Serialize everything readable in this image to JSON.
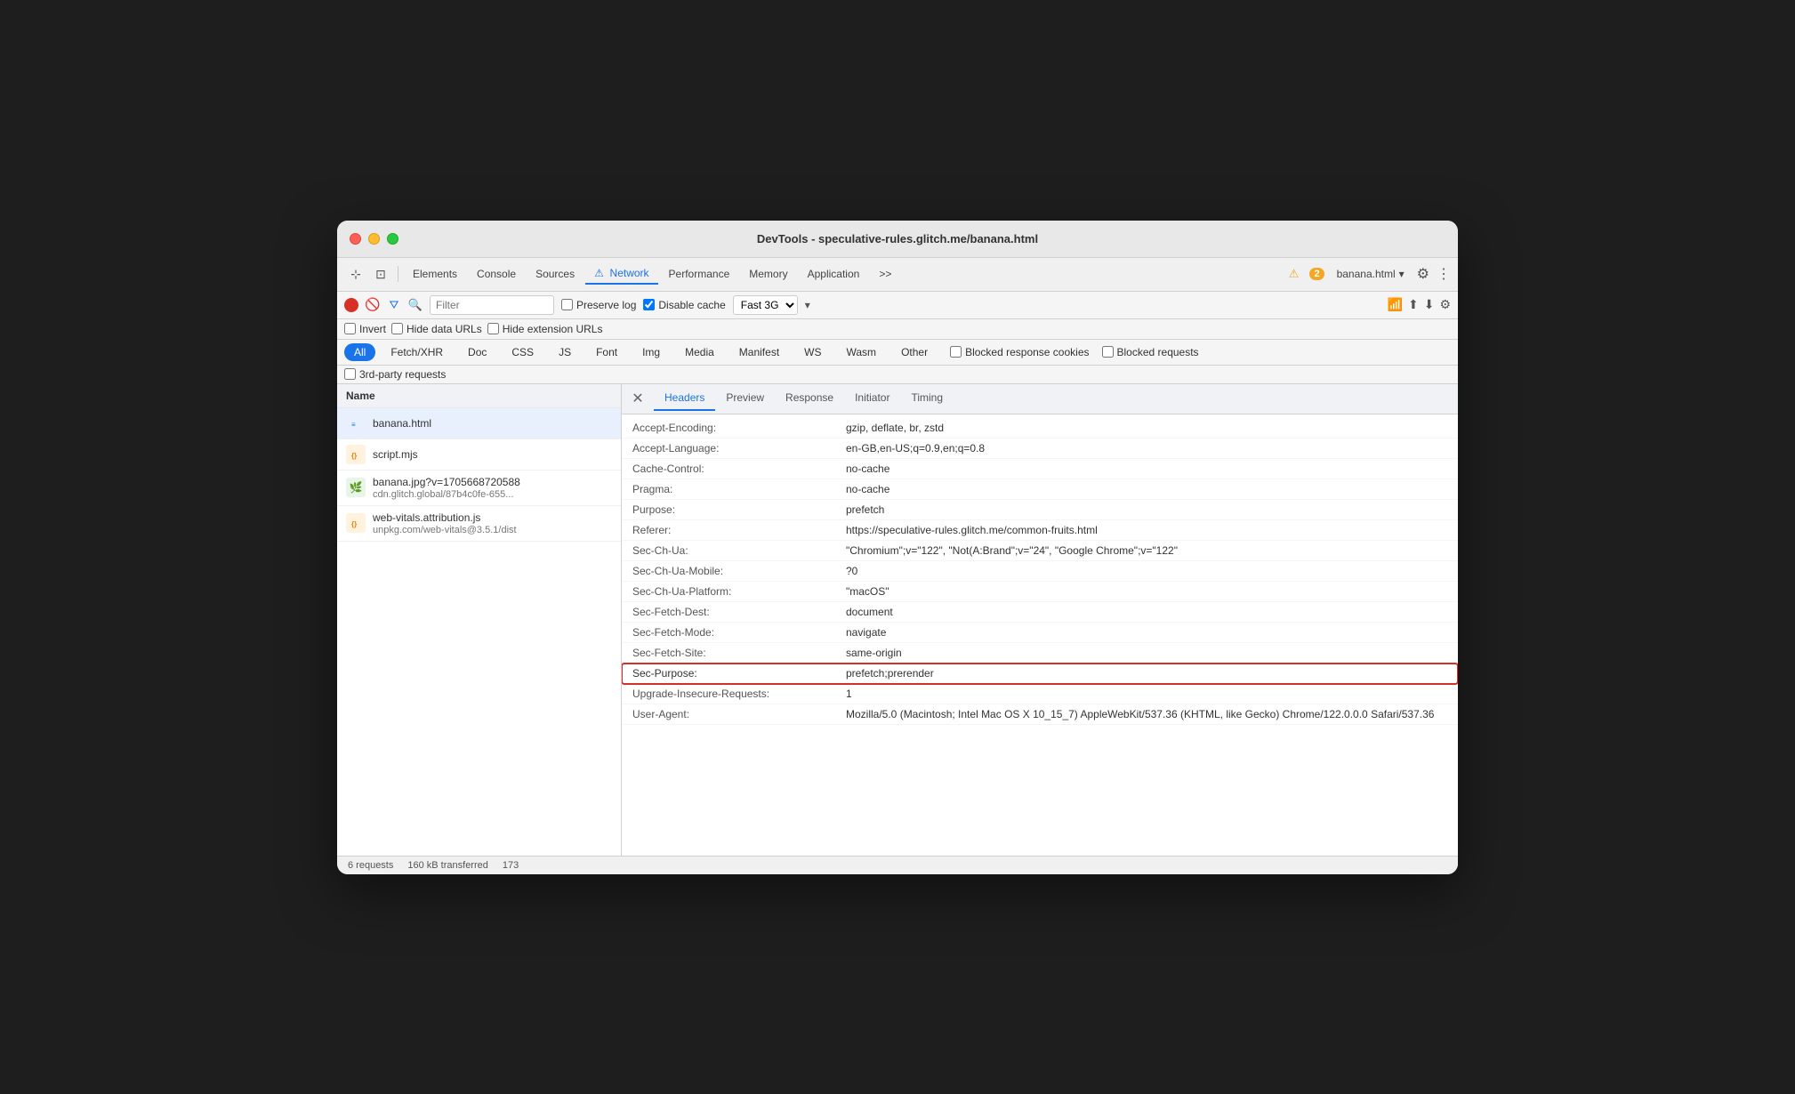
{
  "window": {
    "title": "DevTools - speculative-rules.glitch.me/banana.html"
  },
  "toolbar": {
    "tabs": [
      {
        "id": "elements",
        "label": "Elements",
        "active": false
      },
      {
        "id": "console",
        "label": "Console",
        "active": false
      },
      {
        "id": "sources",
        "label": "Sources",
        "active": false
      },
      {
        "id": "network",
        "label": "⚠ Network",
        "active": true
      },
      {
        "id": "performance",
        "label": "Performance",
        "active": false
      },
      {
        "id": "memory",
        "label": "Memory",
        "active": false
      },
      {
        "id": "application",
        "label": "Application",
        "active": false
      },
      {
        "id": "more",
        "label": ">>",
        "active": false
      }
    ],
    "warning_count": "2",
    "filename": "banana.html"
  },
  "controls": {
    "preserve_log": "Preserve log",
    "disable_cache": "Disable cache",
    "throttle": "Fast 3G",
    "filter_placeholder": "Filter",
    "invert": "Invert",
    "hide_data_urls": "Hide data URLs",
    "hide_extension_urls": "Hide extension URLs"
  },
  "filter_chips": [
    {
      "id": "all",
      "label": "All",
      "active": true
    },
    {
      "id": "fetch_xhr",
      "label": "Fetch/XHR",
      "active": false
    },
    {
      "id": "doc",
      "label": "Doc",
      "active": false
    },
    {
      "id": "css",
      "label": "CSS",
      "active": false
    },
    {
      "id": "js",
      "label": "JS",
      "active": false
    },
    {
      "id": "font",
      "label": "Font",
      "active": false
    },
    {
      "id": "img",
      "label": "Img",
      "active": false
    },
    {
      "id": "media",
      "label": "Media",
      "active": false
    },
    {
      "id": "manifest",
      "label": "Manifest",
      "active": false
    },
    {
      "id": "ws",
      "label": "WS",
      "active": false
    },
    {
      "id": "wasm",
      "label": "Wasm",
      "active": false
    },
    {
      "id": "other",
      "label": "Other",
      "active": false
    }
  ],
  "blocked": {
    "response_cookies": "Blocked response cookies",
    "requests": "Blocked requests"
  },
  "third_party": "3rd-party requests",
  "sidebar": {
    "header": "Name",
    "items": [
      {
        "id": "banana-html",
        "name": "banana.html",
        "url": "",
        "icon_type": "html",
        "selected": true
      },
      {
        "id": "script-mjs",
        "name": "script.mjs",
        "url": "",
        "icon_type": "js",
        "selected": false
      },
      {
        "id": "banana-jpg",
        "name": "banana.jpg?v=1705668720588",
        "url": "cdn.glitch.global/87b4c0fe-655...",
        "icon_type": "img",
        "selected": false
      },
      {
        "id": "web-vitals-js",
        "name": "web-vitals.attribution.js",
        "url": "unpkg.com/web-vitals@3.5.1/dist",
        "icon_type": "js",
        "selected": false
      }
    ]
  },
  "detail": {
    "tabs": [
      {
        "id": "headers",
        "label": "Headers",
        "active": true
      },
      {
        "id": "preview",
        "label": "Preview",
        "active": false
      },
      {
        "id": "response",
        "label": "Response",
        "active": false
      },
      {
        "id": "initiator",
        "label": "Initiator",
        "active": false
      },
      {
        "id": "timing",
        "label": "Timing",
        "active": false
      }
    ],
    "headers": [
      {
        "name": "Accept-Encoding:",
        "value": "gzip, deflate, br, zstd",
        "highlighted": false
      },
      {
        "name": "Accept-Language:",
        "value": "en-GB,en-US;q=0.9,en;q=0.8",
        "highlighted": false
      },
      {
        "name": "Cache-Control:",
        "value": "no-cache",
        "highlighted": false
      },
      {
        "name": "Pragma:",
        "value": "no-cache",
        "highlighted": false
      },
      {
        "name": "Purpose:",
        "value": "prefetch",
        "highlighted": false
      },
      {
        "name": "Referer:",
        "value": "https://speculative-rules.glitch.me/common-fruits.html",
        "highlighted": false
      },
      {
        "name": "Sec-Ch-Ua:",
        "value": "\"Chromium\";v=\"122\", \"Not(A:Brand\";v=\"24\", \"Google Chrome\";v=\"122\"",
        "highlighted": false
      },
      {
        "name": "Sec-Ch-Ua-Mobile:",
        "value": "?0",
        "highlighted": false
      },
      {
        "name": "Sec-Ch-Ua-Platform:",
        "value": "\"macOS\"",
        "highlighted": false
      },
      {
        "name": "Sec-Fetch-Dest:",
        "value": "document",
        "highlighted": false
      },
      {
        "name": "Sec-Fetch-Mode:",
        "value": "navigate",
        "highlighted": false
      },
      {
        "name": "Sec-Fetch-Site:",
        "value": "same-origin",
        "highlighted": false
      },
      {
        "name": "Sec-Purpose:",
        "value": "prefetch;prerender",
        "highlighted": true
      },
      {
        "name": "Upgrade-Insecure-Requests:",
        "value": "1",
        "highlighted": false
      },
      {
        "name": "User-Agent:",
        "value": "Mozilla/5.0 (Macintosh; Intel Mac OS X 10_15_7) AppleWebKit/537.36 (KHTML, like Gecko) Chrome/122.0.0.0 Safari/537.36",
        "highlighted": false
      }
    ]
  },
  "status_bar": {
    "requests": "6 requests",
    "transferred": "160 kB transferred",
    "size": "173"
  }
}
